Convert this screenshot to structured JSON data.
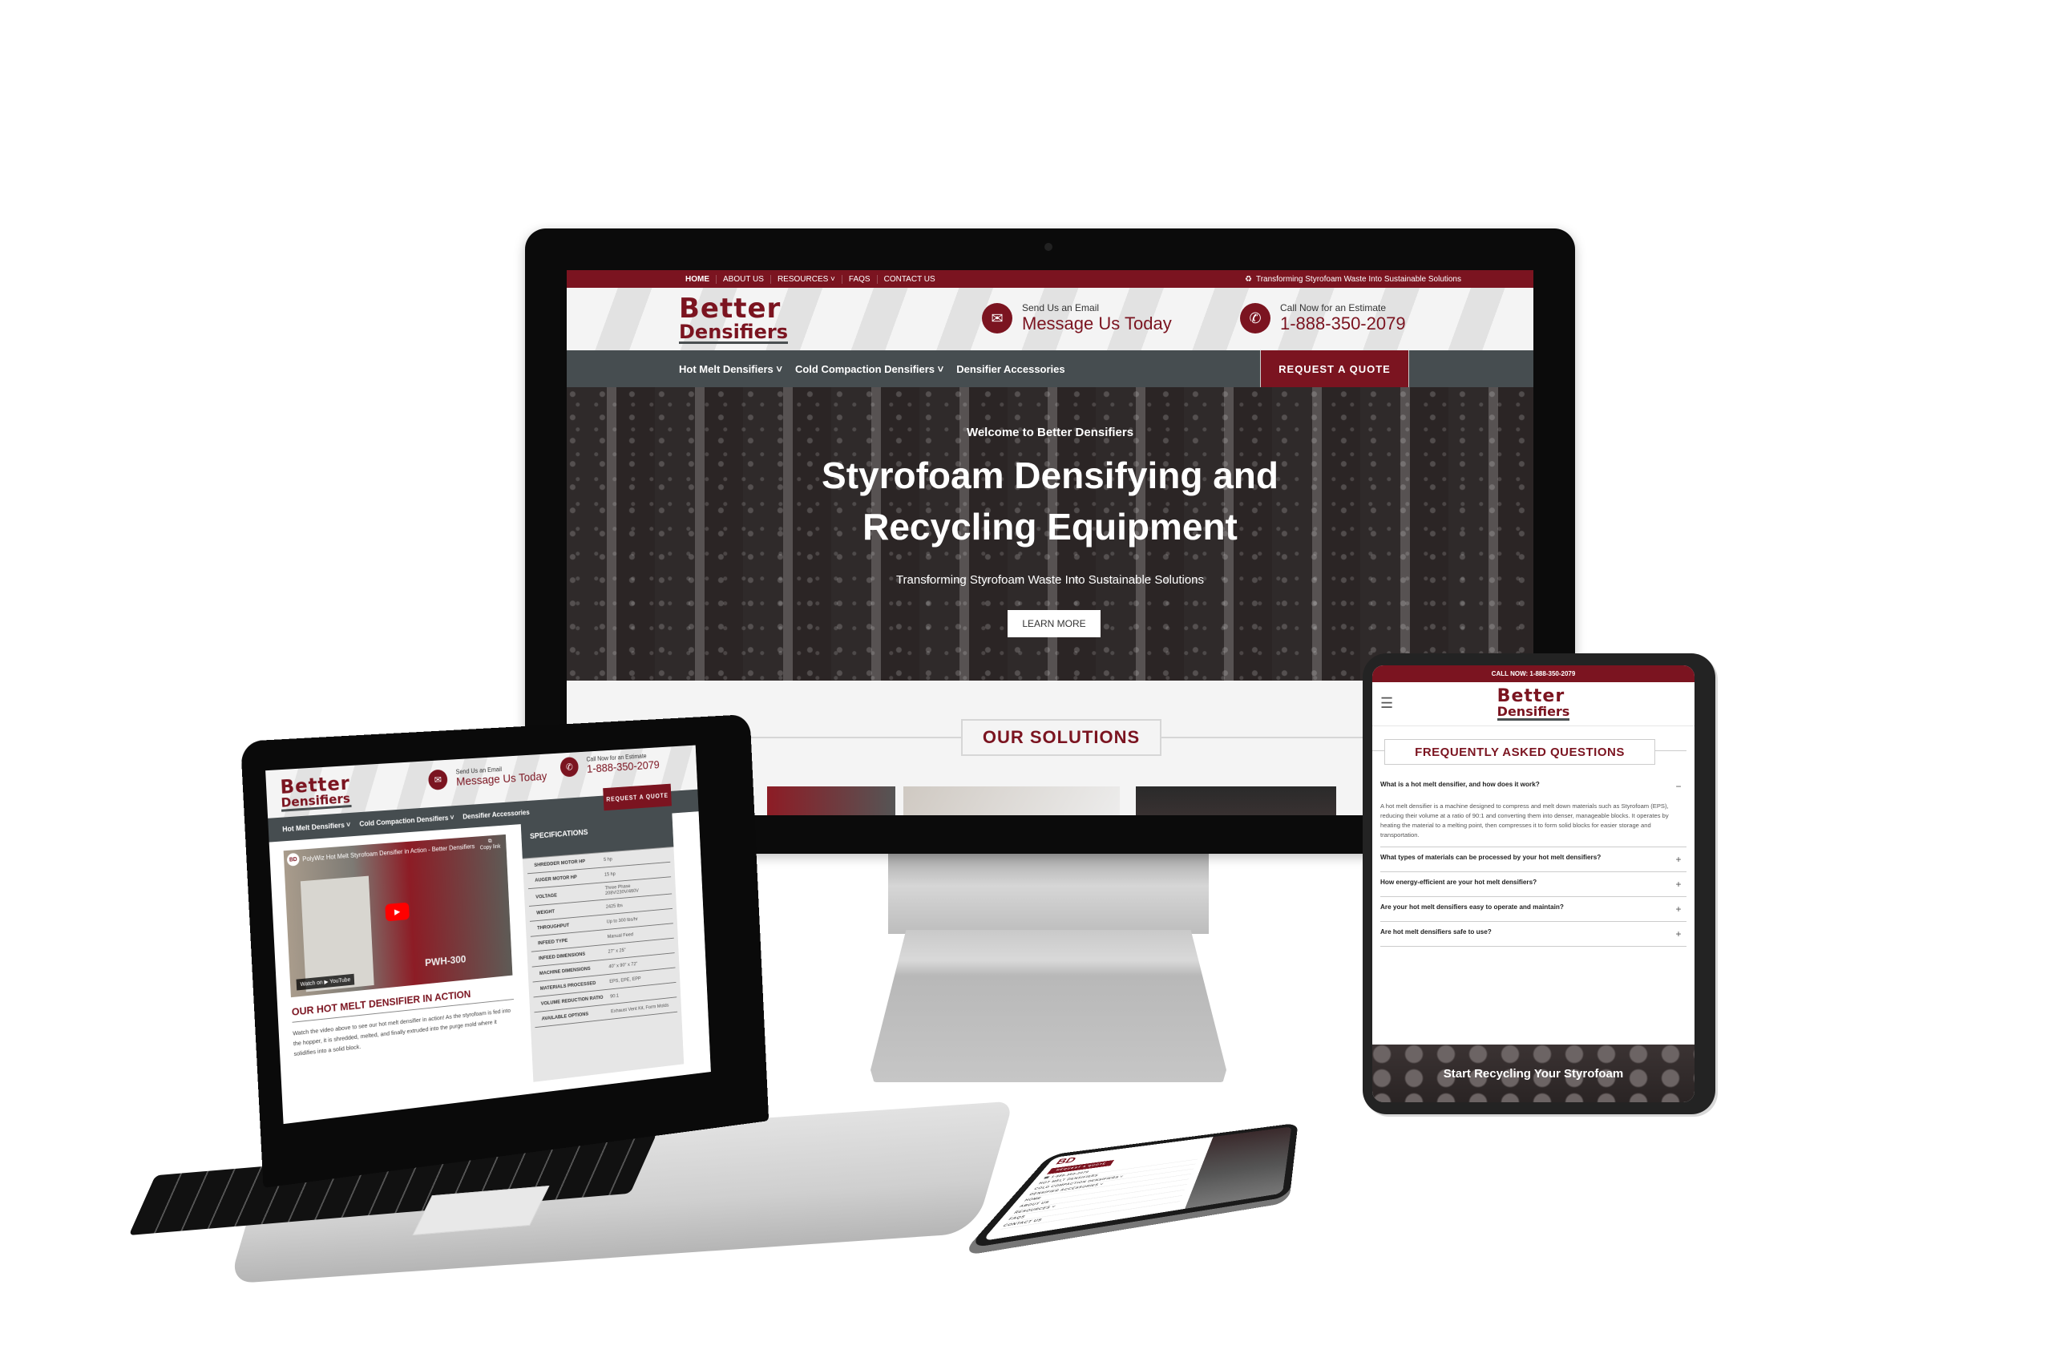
{
  "brand": {
    "logo_line1": "Better",
    "logo_line2": "Densifiers",
    "accent_color": "#7b1420",
    "nav_color": "#464d50"
  },
  "desktop": {
    "top_nav": [
      "HOME",
      "ABOUT US",
      "RESOURCES ˅",
      "FAQS",
      "CONTACT US"
    ],
    "top_tagline_icon": "recycle-icon",
    "top_tagline": "Transforming Styrofoam Waste Into Sustainable Solutions",
    "email_small": "Send Us an Email",
    "email_big": "Message Us Today",
    "phone_small": "Call Now for an Estimate",
    "phone_big": "1-888-350-2079",
    "main_nav": [
      "Hot Melt Densifiers ˅",
      "Cold Compaction Densifiers ˅",
      "Densifier Accessories"
    ],
    "quote_button": "REQUEST A QUOTE",
    "hero": {
      "welcome": "Welcome to Better Densifiers",
      "title_line1": "Styrofoam Densifying and",
      "title_line2": "Recycling Equipment",
      "subtitle": "Transforming Styrofoam Waste Into Sustainable Solutions",
      "button": "LEARN MORE"
    },
    "solutions_title": "OUR SOLUTIONS"
  },
  "laptop": {
    "email_small": "Send Us an Email",
    "email_big": "Message Us Today",
    "phone_small": "Call Now for an Estimate",
    "phone_big": "1-888-350-2079",
    "main_nav": [
      "Hot Melt Densifiers ˅",
      "Cold Compaction Densifiers ˅",
      "Densifier Accessories"
    ],
    "quote_button": "REQUEST A QUOTE",
    "video": {
      "channel_badge": "BD",
      "title": "PolyWiz Hot Melt Styrofoam Densifier in Action - Better Densifiers",
      "copy_link": "Copy link",
      "watch_on": "Watch on ▶ YouTube",
      "model_label": "PWH-300"
    },
    "section_title": "OUR HOT MELT DENSIFIER IN ACTION",
    "paragraph": "Watch the video above to see our hot melt densifier in action! As the styrofoam is fed into the hopper, it is shredded, melted, and finally extruded into the purge mold where it solidifies into a solid block.",
    "specs_title": "SPECIFICATIONS",
    "specs": [
      {
        "label": "SHREDDER MOTOR HP",
        "value": "5 hp"
      },
      {
        "label": "AUGER MOTOR HP",
        "value": "15 hp"
      },
      {
        "label": "VOLTAGE",
        "value": "Three Phase 208V/230V/460V"
      },
      {
        "label": "WEIGHT",
        "value": "2425 lbs"
      },
      {
        "label": "THROUGHPUT",
        "value": "Up to 300 lbs/hr"
      },
      {
        "label": "INFEED TYPE",
        "value": "Manual Feed"
      },
      {
        "label": "INFEED DIMENSIONS",
        "value": "27\" x 25\""
      },
      {
        "label": "MACHINE DIMENSIONS",
        "value": "40\" x 90\" x 72\""
      },
      {
        "label": "MATERIALS PROCESSED",
        "value": "EPS, EPE, EPP"
      },
      {
        "label": "VOLUME REDUCTION RATIO",
        "value": "90:1"
      },
      {
        "label": "AVAILABLE OPTIONS",
        "value": "Exhaust Vent Kit, Form Molds"
      }
    ]
  },
  "tablet": {
    "call_bar": "CALL NOW: 1-888-350-2079",
    "faq_title": "FREQUENTLY ASKED QUESTIONS",
    "faqs": [
      {
        "question": "What is a hot melt densifier, and how does it work?",
        "icon": "−",
        "expanded": true,
        "answer": "A hot melt densifier is a machine designed to compress and melt down materials such as Styrofoam (EPS), reducing their volume at a ratio of 90:1 and converting them into denser, manageable blocks. It operates by heating the material to a melting point, then compresses it to form solid blocks for easier storage and transportation."
      },
      {
        "question": "What types of materials can be processed by your hot melt densifiers?",
        "icon": "+",
        "expanded": false
      },
      {
        "question": "How energy-efficient are your hot melt densifiers?",
        "icon": "+",
        "expanded": false
      },
      {
        "question": "Are your hot melt densifiers easy to operate and maintain?",
        "icon": "+",
        "expanded": false
      },
      {
        "question": "Are hot melt densifiers safe to use?",
        "icon": "+",
        "expanded": false
      }
    ],
    "cta_title": "Start Recycling Your Styrofoam"
  },
  "phone": {
    "logo": "BD",
    "quote_button": "REQUEST A QUOTE",
    "menu": [
      "☎ 1-888-350-2079",
      "HOT MELT DENSIFIERS",
      "COLD COMPACTION DENSIFIERS ˅",
      "DENSIFIER ACCESSORIES ˅",
      "HOME",
      "ABOUT US",
      "RESOURCES ˅",
      "FAQS",
      "CONTACT US"
    ]
  }
}
